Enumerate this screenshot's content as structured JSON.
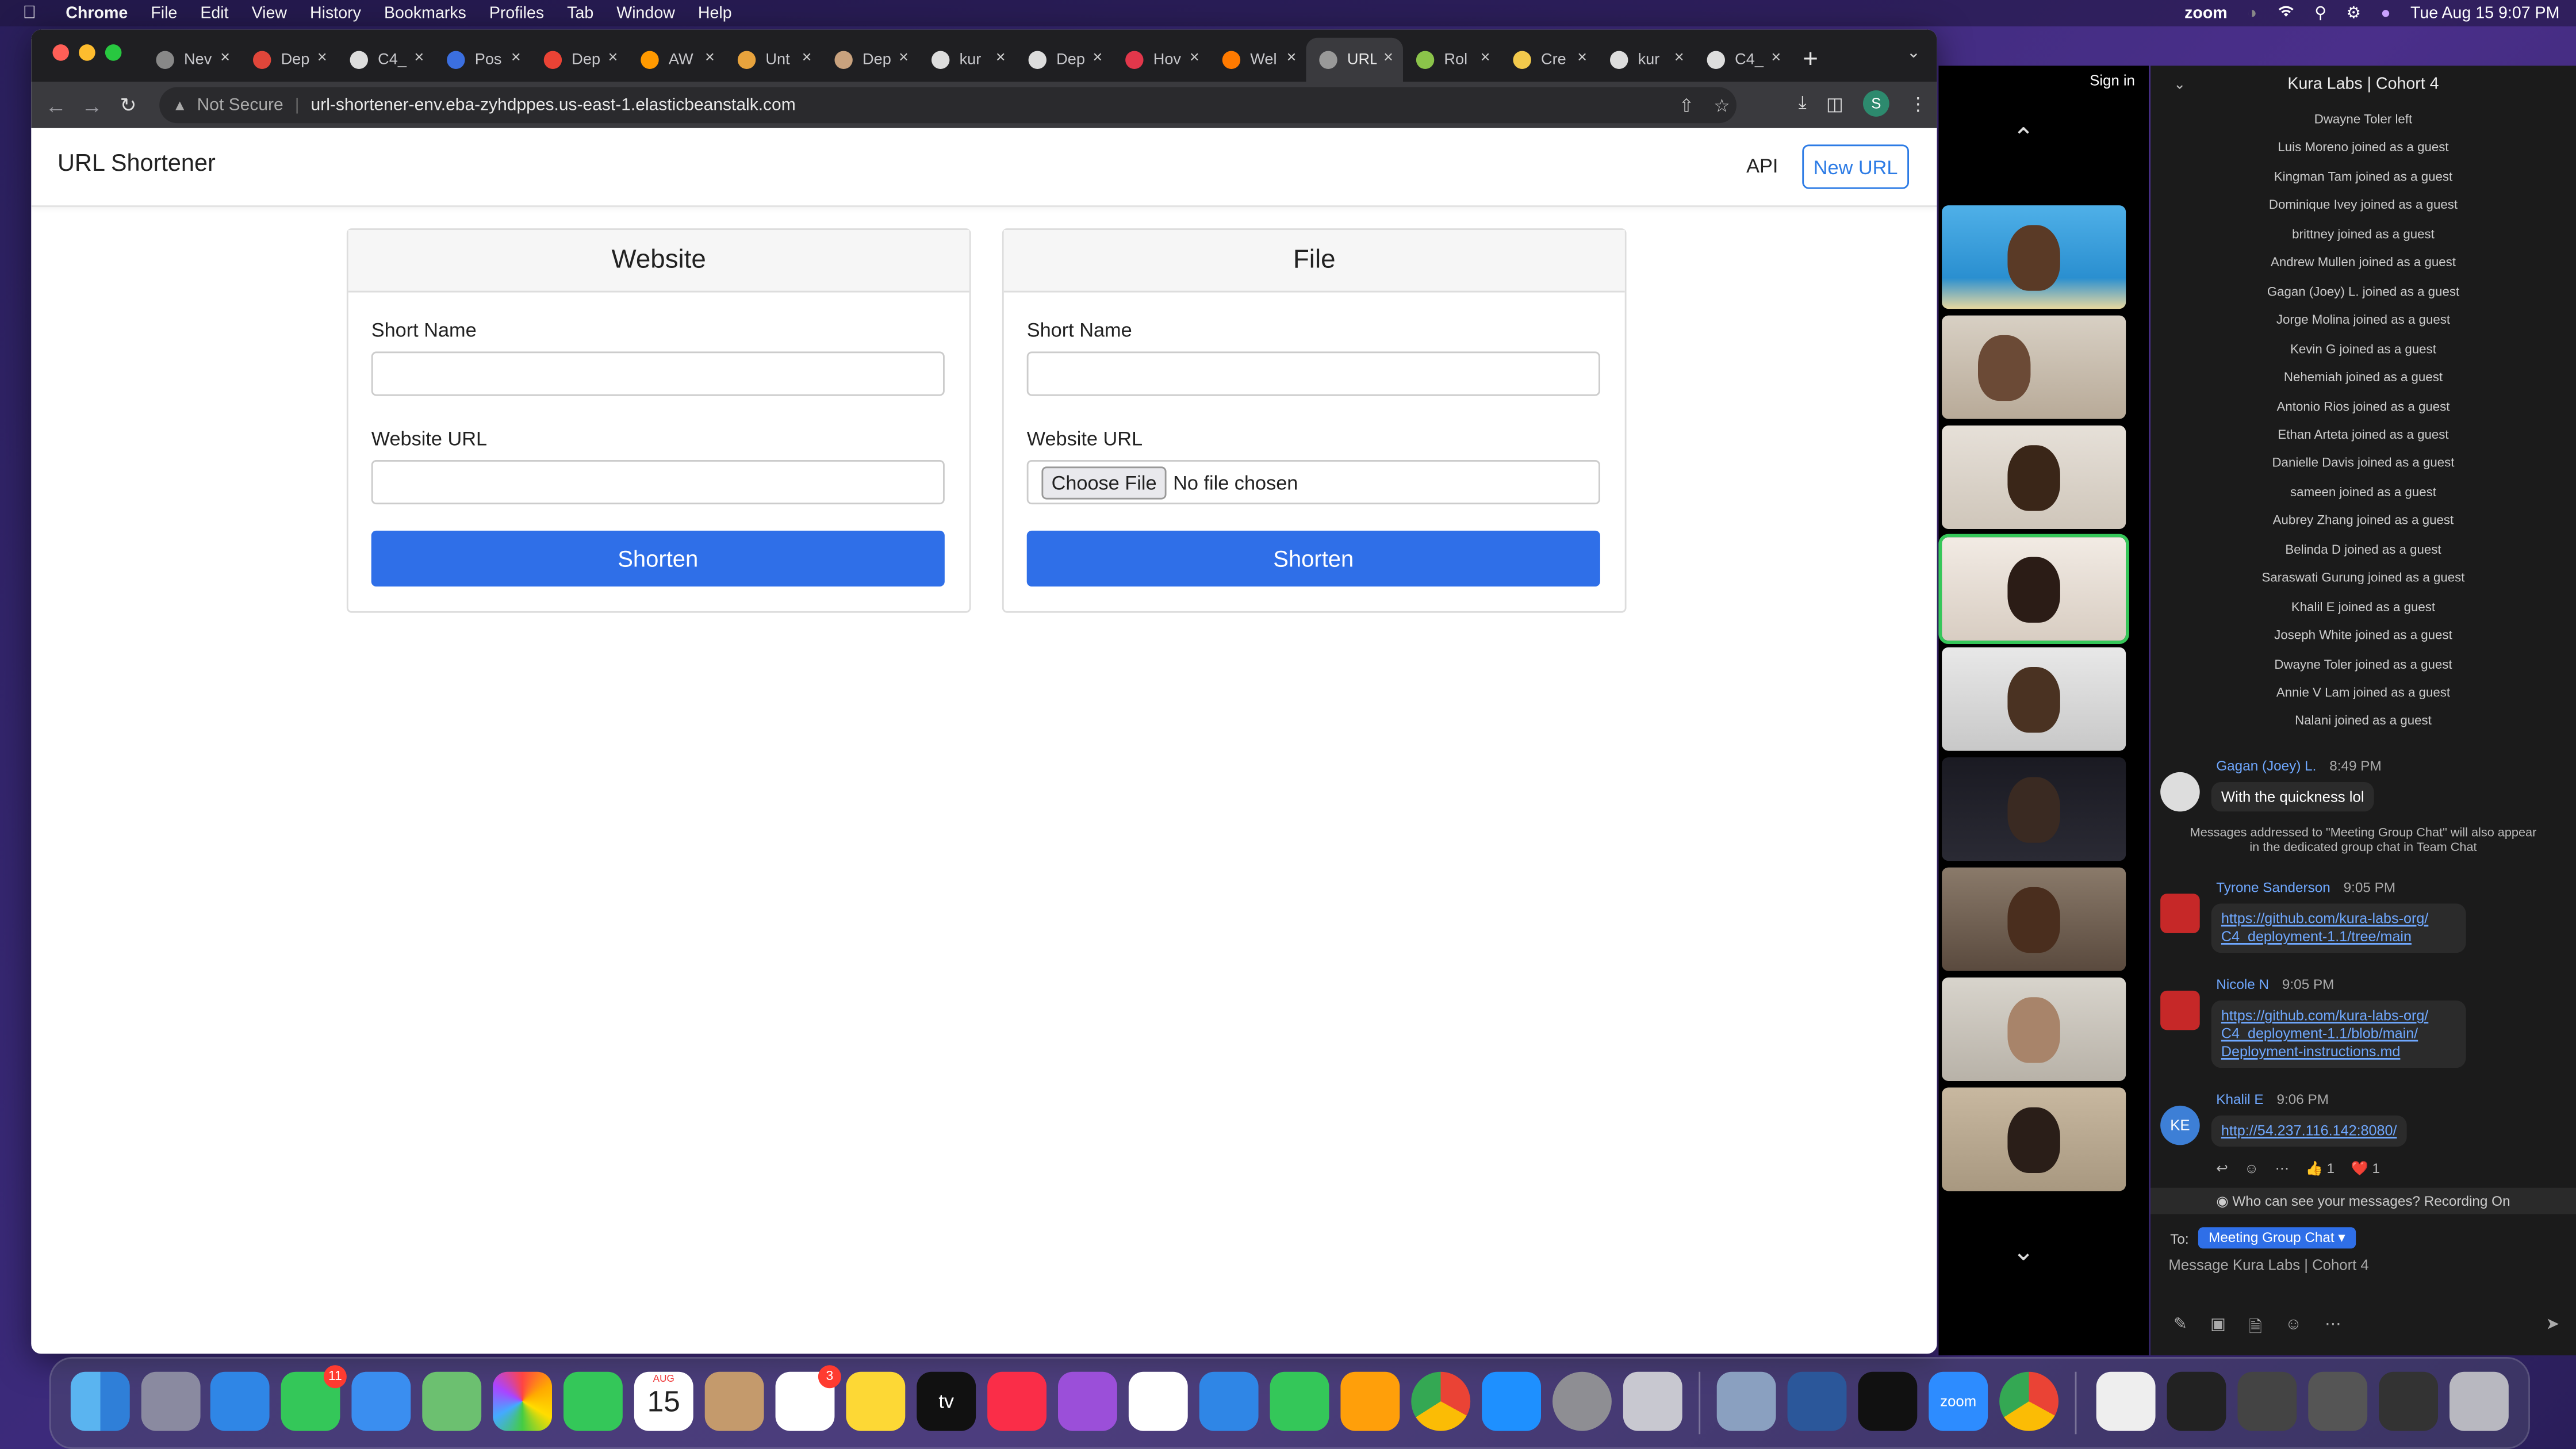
{
  "menubar": {
    "app": "Chrome",
    "items": [
      "File",
      "Edit",
      "View",
      "History",
      "Bookmarks",
      "Profiles",
      "Tab",
      "Window",
      "Help"
    ],
    "zoom_label": "zoom",
    "datetime": "Tue Aug 15  9:07 PM"
  },
  "browser": {
    "tabs": [
      {
        "title": "Nev",
        "color": "#888"
      },
      {
        "title": "Dep",
        "color": "#e0463a"
      },
      {
        "title": "C4_",
        "color": "#ddd"
      },
      {
        "title": "Pos",
        "color": "#3b6fe0"
      },
      {
        "title": "Dep",
        "color": "#ea4335"
      },
      {
        "title": "AW",
        "color": "#ff9900"
      },
      {
        "title": "Unt",
        "color": "#e8a33d"
      },
      {
        "title": "Dep",
        "color": "#c9a27e"
      },
      {
        "title": "kur",
        "color": "#ddd"
      },
      {
        "title": "Dep",
        "color": "#ddd"
      },
      {
        "title": "Hov",
        "color": "#e2374b"
      },
      {
        "title": "Wel",
        "color": "#ff7a00"
      },
      {
        "title": "URL",
        "color": "#999"
      },
      {
        "title": "Rol",
        "color": "#8bc34a"
      },
      {
        "title": "Cre",
        "color": "#f2c94c"
      },
      {
        "title": "kur",
        "color": "#ddd"
      },
      {
        "title": "C4_",
        "color": "#ddd"
      }
    ],
    "active_tab_index": 12,
    "not_secure": "Not Secure",
    "url": "url-shortener-env.eba-zyhdppes.us-east-1.elasticbeanstalk.com",
    "profile_initial": "S"
  },
  "app": {
    "brand": "URL Shortener",
    "nav_api": "API",
    "nav_new": "New URL",
    "website_card": {
      "title": "Website",
      "short_name_label": "Short Name",
      "short_name_value": "",
      "url_label": "Website URL",
      "url_value": "",
      "button": "Shorten"
    },
    "file_card": {
      "title": "File",
      "short_name_label": "Short Name",
      "short_name_value": "",
      "url_label": "Website URL",
      "choose_file": "Choose File",
      "no_file": "No file chosen",
      "button": "Shorten"
    }
  },
  "zoom": {
    "sign_in": "Sign in",
    "chat_title": "Kura Labs | Cohort 4",
    "system_messages": [
      "Dwayne Toler left",
      "Luis Moreno joined as a guest",
      "Kingman Tam joined as a guest",
      "Dominique Ivey joined as a guest",
      "brittney joined as a guest",
      "Andrew Mullen joined as a guest",
      "Gagan (Joey) L. joined as a guest",
      "Jorge Molina joined as a guest",
      "Kevin G joined as a guest",
      "Nehemiah joined as a guest",
      "Antonio Rios joined as a guest",
      "Ethan Arteta joined as a guest",
      "Danielle Davis joined as a guest",
      "sameen joined as a guest",
      "Aubrey Zhang joined as a guest",
      "Belinda D joined as a guest",
      "Saraswati Gurung joined as a guest",
      "Khalil E joined as a guest",
      "Joseph White joined as a guest",
      "Dwayne Toler joined as a guest",
      "Annie V Lam joined as a guest",
      "Nalani joined as a guest"
    ],
    "messages": [
      {
        "name": "Gagan (Joey) L.",
        "time": "8:49 PM",
        "text": "With the quickness lol"
      },
      {
        "name": "Tyrone Sanderson",
        "time": "9:05 PM",
        "link_lines": [
          "https://github.com/kura-labs-org/",
          "C4_deployment-1.1/tree/main"
        ]
      },
      {
        "name": "Nicole N",
        "time": "9:05 PM",
        "link_lines": [
          "https://github.com/kura-labs-org/",
          "C4_deployment-1.1/blob/main/",
          "Deployment-instructions.md"
        ]
      },
      {
        "name": "Khalil E",
        "time": "9:06 PM",
        "initials": "KE",
        "link_lines": [
          "http://54.237.116.142:8080/"
        ]
      }
    ],
    "group_note_line1": "Messages addressed to \"Meeting Group Chat\" will also appear",
    "group_note_line2": "in the dedicated group chat in Team Chat",
    "reaction_like": "👍 1",
    "reaction_heart": "❤️ 1",
    "who_can_see": "Who can see your messages? Recording On",
    "to_label": "To:",
    "to_target": "Meeting Group Chat ▾",
    "message_placeholder": "Message Kura Labs | Cohort 4"
  },
  "dock": {
    "messages_badge": "11",
    "reminders_badge": "3",
    "calendar_month": "AUG",
    "calendar_day": "15",
    "appletv_label": "tv",
    "zoom_label": "zoom"
  }
}
